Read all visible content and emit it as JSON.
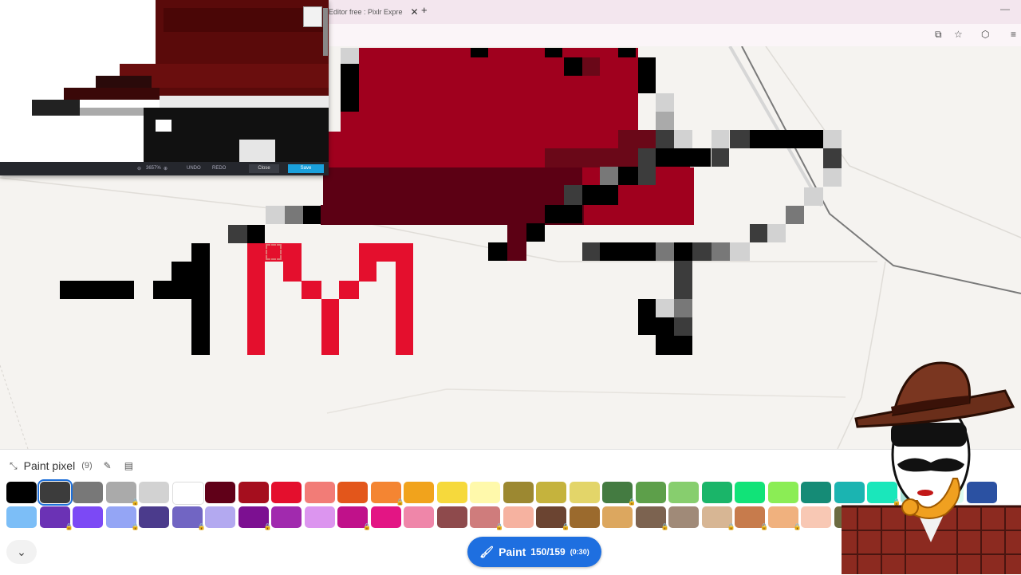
{
  "browser": {
    "tab_title": "Editor free : Pixlr Expre",
    "tab_close": "✕",
    "new_tab": "+",
    "minimize": "—"
  },
  "pixlr": {
    "zoom": "3657%",
    "undo_label": "UNDO",
    "redo_label": "REDO",
    "close_label": "Close",
    "save_label": "Save"
  },
  "panel": {
    "title": "Paint pixel",
    "count": "(9)",
    "paint_label": "Paint",
    "paint_count": "150/159",
    "paint_time": "(0:30)",
    "collapse_icon": "chevron-down-icon"
  },
  "palette": {
    "row1": [
      "#000000",
      "#3c3c3c",
      "#787878",
      "#aaaaaa",
      "#d2d2d2",
      "#ffffff",
      "#600018",
      "#a50e1e",
      "#e40f2d",
      "#f27c77",
      "#e3561b",
      "#f48532",
      "#f1a31c",
      "#f6d93c",
      "#fff9ab",
      "#9c8831",
      "#c5b33d",
      "#e3d569",
      "#447b41",
      "#5d9f4a",
      "#87ce6e",
      "#1ab569",
      "#11e378",
      "#8bed55",
      "#158b76",
      "#1bb4b1",
      "#1ae7bb",
      "#a8e0d6",
      "#dcfbf0",
      "#2b51a2"
    ],
    "row2": [
      "#7cbef7",
      "#6b32b5",
      "#7c49f5",
      "#94a5f5",
      "#4b3b8c",
      "#7165c3",
      "#b3a9f0",
      "#7c1091",
      "#a12aae",
      "#dc95ef",
      "#c0118a",
      "#e31584",
      "#ef86a9",
      "#8e4a4c",
      "#cf7c7c",
      "#f6b2a0",
      "#6b4431",
      "#9b6a2d",
      "#dca75f",
      "#7c6350",
      "#a08a78",
      "#d7b694",
      "#c77b4c",
      "#f0b17e",
      "#f8c8b4",
      "#6c6b41",
      "#8e8f4e",
      "#c6c68e",
      "#5f6374",
      "#b6b9c9"
    ],
    "locked_row1": [
      3,
      11,
      18,
      26
    ],
    "locked_row2": [
      1,
      3,
      5,
      7,
      10,
      14,
      16,
      19,
      21,
      22,
      23
    ]
  }
}
